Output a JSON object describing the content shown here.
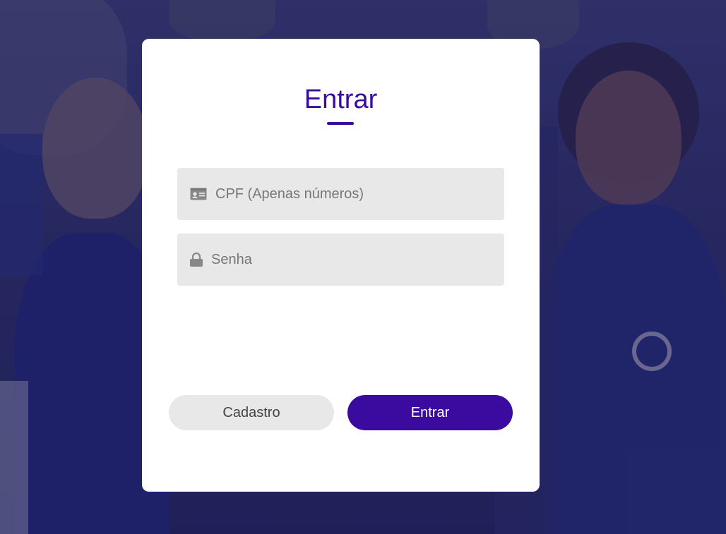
{
  "login": {
    "title": "Entrar",
    "cpf_placeholder": "CPF (Apenas números)",
    "password_placeholder": "Senha",
    "register_label": "Cadastro",
    "submit_label": "Entrar"
  },
  "colors": {
    "accent": "#3b0a9e",
    "field_background": "#e8e8e8",
    "card_background": "#ffffff"
  },
  "icons": {
    "cpf": "id-card-icon",
    "password": "lock-icon"
  }
}
